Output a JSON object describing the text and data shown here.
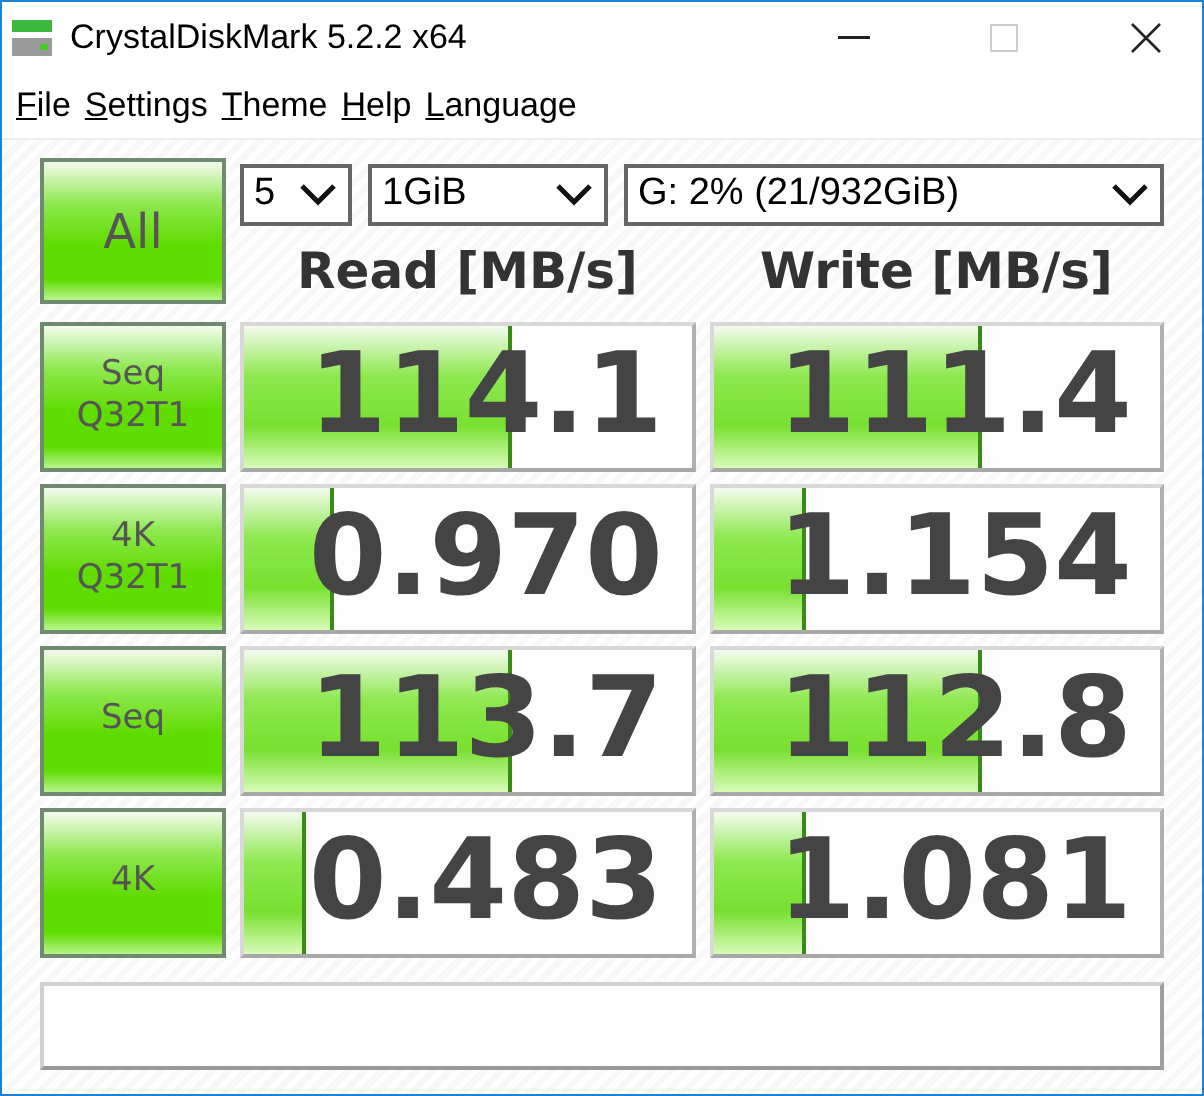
{
  "window": {
    "title": "CrystalDiskMark 5.2.2 x64"
  },
  "menu": [
    "File",
    "Settings",
    "Theme",
    "Help",
    "Language"
  ],
  "all_button": "All",
  "selectors": [
    {
      "value": "5"
    },
    {
      "value": "1GiB"
    },
    {
      "value": "G: 2% (21/932GiB)"
    }
  ],
  "headers": [
    "Read [MB/s]",
    "Write [MB/s]"
  ],
  "rows": [
    {
      "label": [
        "Seq",
        "Q32T1"
      ],
      "read": {
        "value": "114.1",
        "level": 0.6
      },
      "write": {
        "value": "111.4",
        "level": 0.6
      }
    },
    {
      "label": [
        "4K",
        "Q32T1"
      ],
      "read": {
        "value": "0.970",
        "level": 0.2
      },
      "write": {
        "value": "1.154",
        "level": 0.21
      }
    },
    {
      "label": [
        "Seq"
      ],
      "read": {
        "value": "113.7",
        "level": 0.6
      },
      "write": {
        "value": "112.8",
        "level": 0.6
      }
    },
    {
      "label": [
        "4K"
      ],
      "read": {
        "value": "0.483",
        "level": 0.14
      },
      "write": {
        "value": "1.081",
        "level": 0.21
      }
    }
  ]
}
